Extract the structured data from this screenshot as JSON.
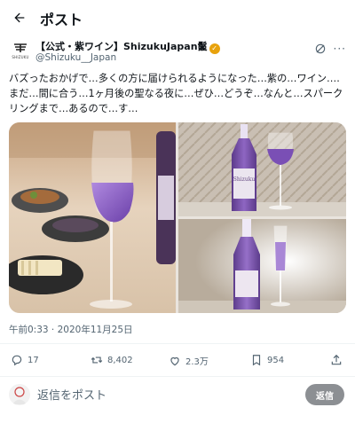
{
  "header": {
    "title": "ポスト"
  },
  "author": {
    "name": "【公式・紫ワイン】ShizukuJapan",
    "name_suffix_badge": "鬣",
    "handle": "@Shizuku__Japan",
    "avatar_mark": "",
    "avatar_brand": "SHIZUKU"
  },
  "post": {
    "text": "バズったおかげで…多くの方に届けられるようになった…紫の…ワイン….まだ…間に合う…1ヶ月後の聖なる夜に…ぜひ…どうぞ…なんと…スパークリングまで…あるので…す…"
  },
  "media": {
    "bottle_label": "Shizuku"
  },
  "meta": {
    "timestamp": "午前0:33 · 2020年11月25日"
  },
  "actions": {
    "replies": "17",
    "reposts": "8,402",
    "likes": "2.3万",
    "bookmarks": "954"
  },
  "reply": {
    "placeholder": "返信をポスト",
    "button": "返信"
  },
  "colors": {
    "accent_verified": "#e8a20c",
    "wine_purple": "#7a4fb5",
    "reply_button": "#8c8f93"
  },
  "icons": [
    "back-arrow-icon",
    "verified-badge-icon",
    "grok-icon",
    "more-icon",
    "reply-icon",
    "repost-icon",
    "like-icon",
    "bookmark-icon",
    "share-icon"
  ]
}
